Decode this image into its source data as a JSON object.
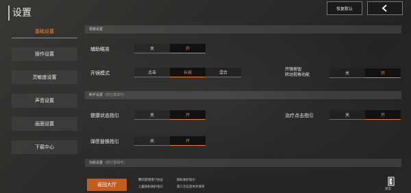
{
  "header": {
    "title": "设置",
    "reset_label": "恢复默认",
    "back_icon": "chevron-left-icon"
  },
  "sidebar": {
    "items": [
      {
        "label": "基础设置",
        "active": true
      },
      {
        "label": "操作设置",
        "active": false
      },
      {
        "label": "灵敏度设置",
        "active": false
      },
      {
        "label": "声音设置",
        "active": false
      },
      {
        "label": "画面设置",
        "active": false
      },
      {
        "label": "下载中心",
        "active": false
      }
    ]
  },
  "sections": {
    "sight": {
      "title": "视镜设置"
    },
    "newbie": {
      "title": "新手设置",
      "hint": "(部分基础可)"
    },
    "function": {
      "title": "功能设置",
      "hint": "(部分基础可)"
    }
  },
  "rows": {
    "aim_assist": {
      "label": "辅助瞄准",
      "off": "关",
      "on": "开",
      "value": "开"
    },
    "fire_mode": {
      "label": "开镜模式",
      "options": [
        "点击",
        "长按",
        "混合"
      ],
      "value": "长按"
    },
    "scope_rotate": {
      "label_line1": "开镜按钮",
      "label_line2": "转动视角功能",
      "off": "关",
      "on": "开",
      "value": "开"
    },
    "health_guide": {
      "label": "健康状态指引",
      "off": "关",
      "on": "开",
      "value": "开"
    },
    "heal_guide": {
      "label": "治疗点击指引",
      "off": "关",
      "on": "开",
      "value": "开"
    },
    "ammo_guide": {
      "label": "弹匣替换指引",
      "off": "关",
      "on": "开",
      "value": "开"
    }
  },
  "footer": {
    "back_hall": "返回大厅",
    "links": [
      "腾讯游戏用户协议",
      "隐私保护指引",
      "儿童隐私保护指引",
      "第三方信息共享清单"
    ],
    "exit_label": "退出",
    "exit_icon": "exit-door-icon"
  },
  "colors": {
    "accent": "#ef7a2a",
    "background": "#2b2b2b"
  }
}
